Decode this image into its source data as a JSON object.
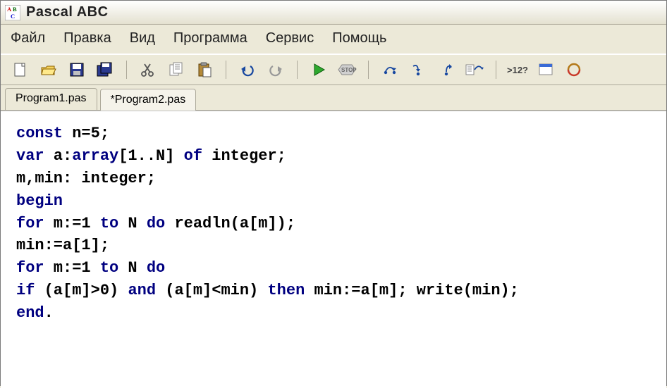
{
  "app_title": "Pascal ABC",
  "menu": [
    "Файл",
    "Правка",
    "Вид",
    "Программа",
    "Сервис",
    "Помощь"
  ],
  "tabs": [
    {
      "label": "Program1.pas",
      "active": false
    },
    {
      "label": "*Program2.pas",
      "active": true
    }
  ],
  "toolbar_icons": [
    "new-file-icon",
    "open-file-icon",
    "save-icon",
    "save-all-icon",
    "sep",
    "cut-icon",
    "copy-icon",
    "paste-icon",
    "sep",
    "undo-icon",
    "redo-icon",
    "sep",
    "run-icon",
    "stop-icon",
    "sep",
    "step-over-icon",
    "step-into-icon",
    "step-out-icon",
    "trace-icon",
    "sep",
    "ascii-icon",
    "form-icon",
    "console-icon"
  ],
  "code": {
    "lines": [
      [
        {
          "t": "const",
          "c": "kw"
        },
        {
          "t": " n=5;",
          "c": "plain"
        }
      ],
      [
        {
          "t": "var",
          "c": "kw"
        },
        {
          "t": " a:",
          "c": "plain"
        },
        {
          "t": "array",
          "c": "kw"
        },
        {
          "t": "[1..N] ",
          "c": "plain"
        },
        {
          "t": "of",
          "c": "kw"
        },
        {
          "t": " integer;",
          "c": "plain"
        }
      ],
      [
        {
          "t": "m,min: integer;",
          "c": "plain"
        }
      ],
      [
        {
          "t": "begin",
          "c": "kw"
        }
      ],
      [
        {
          "t": "for",
          "c": "kw"
        },
        {
          "t": " m:=1 ",
          "c": "plain"
        },
        {
          "t": "to",
          "c": "kw"
        },
        {
          "t": " N ",
          "c": "plain"
        },
        {
          "t": "do",
          "c": "kw"
        },
        {
          "t": " readln(a[m]);",
          "c": "plain"
        }
      ],
      [
        {
          "t": "min:=a[1];",
          "c": "plain"
        }
      ],
      [
        {
          "t": "for",
          "c": "kw"
        },
        {
          "t": " m:=1 ",
          "c": "plain"
        },
        {
          "t": "to",
          "c": "kw"
        },
        {
          "t": " N ",
          "c": "plain"
        },
        {
          "t": "do",
          "c": "kw"
        }
      ],
      [
        {
          "t": "if",
          "c": "kw"
        },
        {
          "t": " (a[m]>0) ",
          "c": "plain"
        },
        {
          "t": "and",
          "c": "kw"
        },
        {
          "t": " (a[m]<min) ",
          "c": "plain"
        },
        {
          "t": "then",
          "c": "kw"
        },
        {
          "t": " min:=a[m]; write(min);",
          "c": "plain"
        }
      ],
      [
        {
          "t": "end",
          "c": "kw"
        },
        {
          "t": ".",
          "c": "plain"
        }
      ]
    ]
  }
}
